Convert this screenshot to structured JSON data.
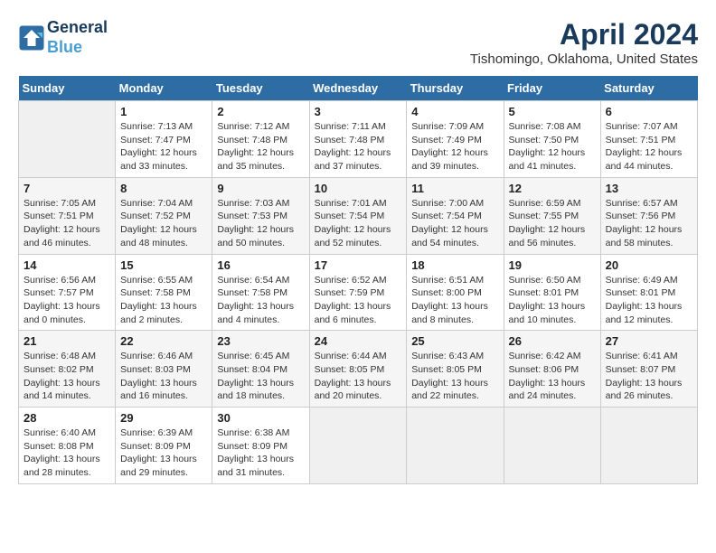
{
  "header": {
    "logo_line1": "General",
    "logo_line2": "Blue",
    "month_year": "April 2024",
    "location": "Tishomingo, Oklahoma, United States"
  },
  "days_of_week": [
    "Sunday",
    "Monday",
    "Tuesday",
    "Wednesday",
    "Thursday",
    "Friday",
    "Saturday"
  ],
  "weeks": [
    [
      {
        "day": "",
        "sunrise": "",
        "sunset": "",
        "daylight": ""
      },
      {
        "day": "1",
        "sunrise": "Sunrise: 7:13 AM",
        "sunset": "Sunset: 7:47 PM",
        "daylight": "Daylight: 12 hours and 33 minutes."
      },
      {
        "day": "2",
        "sunrise": "Sunrise: 7:12 AM",
        "sunset": "Sunset: 7:48 PM",
        "daylight": "Daylight: 12 hours and 35 minutes."
      },
      {
        "day": "3",
        "sunrise": "Sunrise: 7:11 AM",
        "sunset": "Sunset: 7:48 PM",
        "daylight": "Daylight: 12 hours and 37 minutes."
      },
      {
        "day": "4",
        "sunrise": "Sunrise: 7:09 AM",
        "sunset": "Sunset: 7:49 PM",
        "daylight": "Daylight: 12 hours and 39 minutes."
      },
      {
        "day": "5",
        "sunrise": "Sunrise: 7:08 AM",
        "sunset": "Sunset: 7:50 PM",
        "daylight": "Daylight: 12 hours and 41 minutes."
      },
      {
        "day": "6",
        "sunrise": "Sunrise: 7:07 AM",
        "sunset": "Sunset: 7:51 PM",
        "daylight": "Daylight: 12 hours and 44 minutes."
      }
    ],
    [
      {
        "day": "7",
        "sunrise": "Sunrise: 7:05 AM",
        "sunset": "Sunset: 7:51 PM",
        "daylight": "Daylight: 12 hours and 46 minutes."
      },
      {
        "day": "8",
        "sunrise": "Sunrise: 7:04 AM",
        "sunset": "Sunset: 7:52 PM",
        "daylight": "Daylight: 12 hours and 48 minutes."
      },
      {
        "day": "9",
        "sunrise": "Sunrise: 7:03 AM",
        "sunset": "Sunset: 7:53 PM",
        "daylight": "Daylight: 12 hours and 50 minutes."
      },
      {
        "day": "10",
        "sunrise": "Sunrise: 7:01 AM",
        "sunset": "Sunset: 7:54 PM",
        "daylight": "Daylight: 12 hours and 52 minutes."
      },
      {
        "day": "11",
        "sunrise": "Sunrise: 7:00 AM",
        "sunset": "Sunset: 7:54 PM",
        "daylight": "Daylight: 12 hours and 54 minutes."
      },
      {
        "day": "12",
        "sunrise": "Sunrise: 6:59 AM",
        "sunset": "Sunset: 7:55 PM",
        "daylight": "Daylight: 12 hours and 56 minutes."
      },
      {
        "day": "13",
        "sunrise": "Sunrise: 6:57 AM",
        "sunset": "Sunset: 7:56 PM",
        "daylight": "Daylight: 12 hours and 58 minutes."
      }
    ],
    [
      {
        "day": "14",
        "sunrise": "Sunrise: 6:56 AM",
        "sunset": "Sunset: 7:57 PM",
        "daylight": "Daylight: 13 hours and 0 minutes."
      },
      {
        "day": "15",
        "sunrise": "Sunrise: 6:55 AM",
        "sunset": "Sunset: 7:58 PM",
        "daylight": "Daylight: 13 hours and 2 minutes."
      },
      {
        "day": "16",
        "sunrise": "Sunrise: 6:54 AM",
        "sunset": "Sunset: 7:58 PM",
        "daylight": "Daylight: 13 hours and 4 minutes."
      },
      {
        "day": "17",
        "sunrise": "Sunrise: 6:52 AM",
        "sunset": "Sunset: 7:59 PM",
        "daylight": "Daylight: 13 hours and 6 minutes."
      },
      {
        "day": "18",
        "sunrise": "Sunrise: 6:51 AM",
        "sunset": "Sunset: 8:00 PM",
        "daylight": "Daylight: 13 hours and 8 minutes."
      },
      {
        "day": "19",
        "sunrise": "Sunrise: 6:50 AM",
        "sunset": "Sunset: 8:01 PM",
        "daylight": "Daylight: 13 hours and 10 minutes."
      },
      {
        "day": "20",
        "sunrise": "Sunrise: 6:49 AM",
        "sunset": "Sunset: 8:01 PM",
        "daylight": "Daylight: 13 hours and 12 minutes."
      }
    ],
    [
      {
        "day": "21",
        "sunrise": "Sunrise: 6:48 AM",
        "sunset": "Sunset: 8:02 PM",
        "daylight": "Daylight: 13 hours and 14 minutes."
      },
      {
        "day": "22",
        "sunrise": "Sunrise: 6:46 AM",
        "sunset": "Sunset: 8:03 PM",
        "daylight": "Daylight: 13 hours and 16 minutes."
      },
      {
        "day": "23",
        "sunrise": "Sunrise: 6:45 AM",
        "sunset": "Sunset: 8:04 PM",
        "daylight": "Daylight: 13 hours and 18 minutes."
      },
      {
        "day": "24",
        "sunrise": "Sunrise: 6:44 AM",
        "sunset": "Sunset: 8:05 PM",
        "daylight": "Daylight: 13 hours and 20 minutes."
      },
      {
        "day": "25",
        "sunrise": "Sunrise: 6:43 AM",
        "sunset": "Sunset: 8:05 PM",
        "daylight": "Daylight: 13 hours and 22 minutes."
      },
      {
        "day": "26",
        "sunrise": "Sunrise: 6:42 AM",
        "sunset": "Sunset: 8:06 PM",
        "daylight": "Daylight: 13 hours and 24 minutes."
      },
      {
        "day": "27",
        "sunrise": "Sunrise: 6:41 AM",
        "sunset": "Sunset: 8:07 PM",
        "daylight": "Daylight: 13 hours and 26 minutes."
      }
    ],
    [
      {
        "day": "28",
        "sunrise": "Sunrise: 6:40 AM",
        "sunset": "Sunset: 8:08 PM",
        "daylight": "Daylight: 13 hours and 28 minutes."
      },
      {
        "day": "29",
        "sunrise": "Sunrise: 6:39 AM",
        "sunset": "Sunset: 8:09 PM",
        "daylight": "Daylight: 13 hours and 29 minutes."
      },
      {
        "day": "30",
        "sunrise": "Sunrise: 6:38 AM",
        "sunset": "Sunset: 8:09 PM",
        "daylight": "Daylight: 13 hours and 31 minutes."
      },
      {
        "day": "",
        "sunrise": "",
        "sunset": "",
        "daylight": ""
      },
      {
        "day": "",
        "sunrise": "",
        "sunset": "",
        "daylight": ""
      },
      {
        "day": "",
        "sunrise": "",
        "sunset": "",
        "daylight": ""
      },
      {
        "day": "",
        "sunrise": "",
        "sunset": "",
        "daylight": ""
      }
    ]
  ]
}
